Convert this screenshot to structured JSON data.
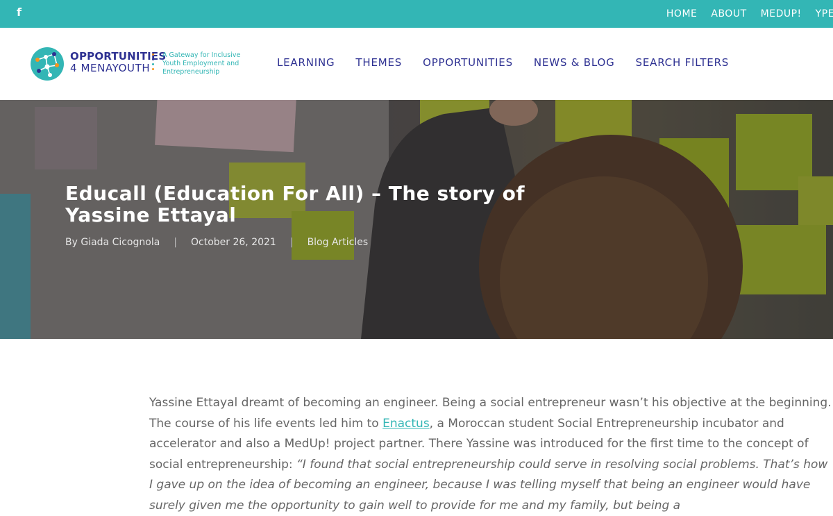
{
  "topbar": {
    "social_icon": "facebook-icon",
    "links": [
      "HOME",
      "ABOUT",
      "MEDUP!",
      "YPE"
    ]
  },
  "header": {
    "logo": {
      "line1": "OPPORTUNITIES",
      "line2": "4 MENAYOUTH",
      "tagline": "A Gateway for Inclusive Youth Employment and Entrepreneurship"
    },
    "nav": [
      "LEARNING",
      "THEMES",
      "OPPORTUNITIES",
      "NEWS & BLOG",
      "SEARCH FILTERS"
    ]
  },
  "hero": {
    "title": "Educall (Education For All) – The story of Yassine Ettayal",
    "author": "By Giada Cicognola",
    "date": "October 26, 2021",
    "category": "Blog Articles"
  },
  "article": {
    "p1_before_link": "Yassine Ettayal dreamt of becoming an engineer. Being a social entrepreneur wasn’t his objective at the beginning. The course of his life events led him to ",
    "link_text": "Enactus",
    "p1_after_link": ", a Moroccan student Social Entrepreneurship incubator and accelerator and also a MedUp! project partner. There Yassine was introduced for the first time to the concept of social entrepreneurship: ",
    "quote": "“I found that social entrepreneurship could serve in resolving social problems. That’s how I gave up on the idea of becoming an engineer, because I was telling myself that being an engineer would have surely given me the opportunity to gain well to provide for me and my family, but being a"
  },
  "colors": {
    "teal": "#33b6b5",
    "navy": "#2e3192",
    "orange": "#f7941d"
  }
}
